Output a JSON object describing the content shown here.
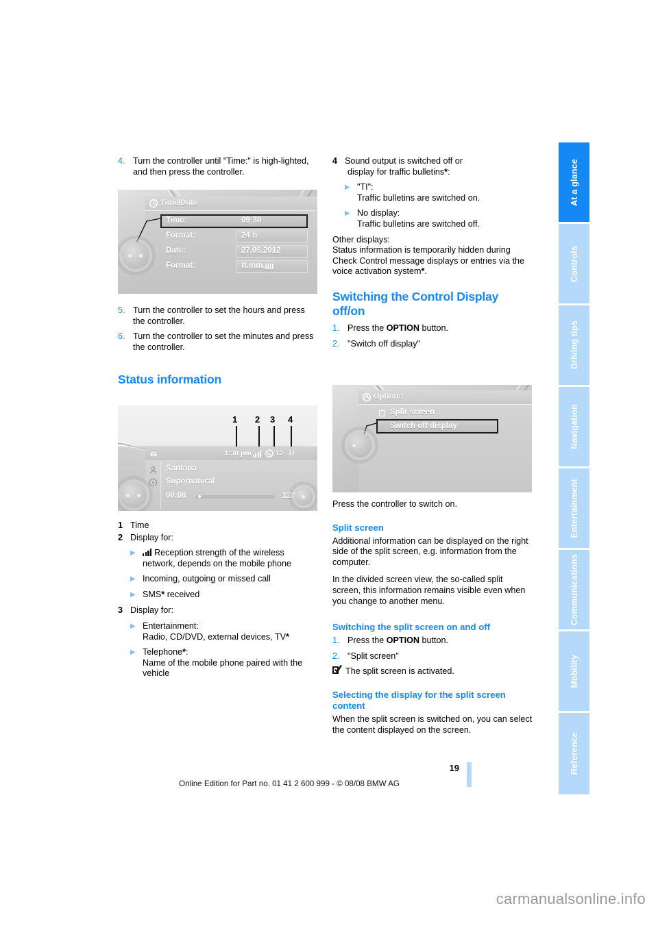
{
  "page": {
    "number": "19",
    "edition_line": "Online Edition for Part no. 01 41 2 600 999 - © 08/08 BMW AG",
    "watermark": "carmanualsonline.info"
  },
  "sidebar": {
    "tabs": [
      {
        "label": "At a glance",
        "active": true
      },
      {
        "label": "Controls",
        "active": false
      },
      {
        "label": "Driving tips",
        "active": false
      },
      {
        "label": "Navigation",
        "active": false
      },
      {
        "label": "Entertainment",
        "active": false
      },
      {
        "label": "Communications",
        "active": false
      },
      {
        "label": "Mobility",
        "active": false
      },
      {
        "label": "Reference",
        "active": false
      }
    ]
  },
  "left_column": {
    "step4": {
      "number": "4.",
      "text": "Turn the controller until \"Time:\" is high-lighted, and then press the controller."
    },
    "step5": {
      "number": "5.",
      "text": "Turn the controller to set the hours and press the controller."
    },
    "step6": {
      "number": "6.",
      "text": "Turn the controller to set the minutes and press the controller."
    },
    "status_heading": "Status information",
    "legend": [
      {
        "number": "1",
        "text": "Time"
      },
      {
        "number": "2",
        "text": "Display for:"
      },
      {
        "number": "3",
        "text": "Display for:"
      }
    ],
    "legend2_bullets": [
      {
        "icon": "signal-bars-icon",
        "text": "Reception strength of the wireless network, depends on the mobile phone"
      },
      {
        "icon": "",
        "text": "Incoming, outgoing or missed call"
      },
      {
        "icon": "",
        "text": "SMS",
        "asterisk": "*",
        "text_after": " received"
      }
    ],
    "legend3_bullets": [
      {
        "line1": "Entertainment:",
        "line2": "Radio, CD/DVD, external devices, TV",
        "asterisk": "*"
      },
      {
        "line1": "Telephone",
        "asterisk": "*",
        "line1_after": ":",
        "line2": "Name of the mobile phone paired with the vehicle"
      }
    ]
  },
  "right_column": {
    "legend4": {
      "number": "4",
      "line1": "Sound output is switched off or",
      "line2": "display for traffic bulletins",
      "asterisk": "*",
      "line2_after": ":"
    },
    "legend4_bullets": [
      {
        "line1": "\"TI\":",
        "line2": "Traffic bulletins are switched on."
      },
      {
        "line1": "No display:",
        "line2": "Traffic bulletins are switched off."
      }
    ],
    "other_displays_label": "Other displays:",
    "other_displays_text": "Status information is temporarily hidden during Check Control message displays or entries via the voice activation system",
    "other_displays_asterisk": "*",
    "other_displays_after": ".",
    "switching_heading": "Switching the Control Display off/on",
    "switching_steps": [
      {
        "number": "1.",
        "pre": "Press the ",
        "bold": "OPTION",
        "post": " button."
      },
      {
        "number": "2.",
        "pre": "\"Switch off display\"",
        "bold": "",
        "post": ""
      }
    ],
    "press_controller_text": "Press the controller to switch on.",
    "split_heading": "Split screen",
    "split_para1": "Additional information can be displayed on the right side of the split screen, e.g. information from the computer.",
    "split_para2": "In the divided screen view, the so-called split screen, this information remains visible even when you change to another menu.",
    "switch_split_heading": "Switching the split screen on and off",
    "switch_split_steps": [
      {
        "number": "1.",
        "pre": "Press the ",
        "bold": "OPTION",
        "post": " button."
      },
      {
        "number": "2.",
        "pre": "\"Split screen\"",
        "bold": "",
        "post": ""
      }
    ],
    "split_activated_text": "The split screen is activated.",
    "split_activated_icon": "checkbox-checked-icon",
    "selecting_heading": "Selecting the display for the split screen content",
    "selecting_text": "When the split screen is switched on, you can select the content displayed on the screen."
  },
  "figures": {
    "timedate": {
      "name": "time-date-menu-screenshot",
      "title": "Time/Date",
      "rows": [
        {
          "label": "Time:",
          "value": "09:30",
          "selected": true
        },
        {
          "label": "Format:",
          "value": "24 h",
          "selected": false
        },
        {
          "label": "Date:",
          "value": "27.05.2012",
          "selected": false
        },
        {
          "label": "Format:",
          "value": "tt.mm.jjjj",
          "selected": false
        }
      ]
    },
    "status": {
      "name": "status-information-screenshot",
      "callouts": [
        "1",
        "2",
        "3",
        "4"
      ],
      "status_bar": {
        "time": "1:30 pm",
        "signal": "signal-bars-icon",
        "phone": "phone-icon",
        "count": "12",
        "traffic": "TI"
      },
      "now_playing": {
        "artist": "Santana",
        "album": "Supernatural",
        "elapsed": "00:08",
        "track": "12/99"
      }
    },
    "options": {
      "name": "options-menu-screenshot",
      "title": "Options",
      "rows": [
        {
          "label": "Split screen",
          "checkbox": true,
          "selected": false
        },
        {
          "label": "Switch off display",
          "checkbox": false,
          "selected": true
        }
      ]
    }
  }
}
